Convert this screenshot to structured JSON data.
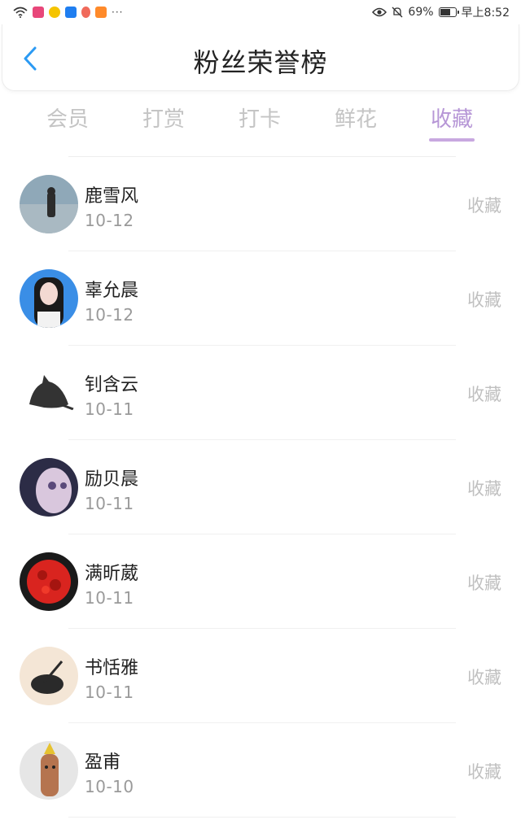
{
  "status_bar": {
    "battery": "69%",
    "time": "早上8:52",
    "battery_level": 0.69
  },
  "header": {
    "title": "粉丝荣誉榜"
  },
  "tabs": [
    {
      "label": "会员",
      "active": false
    },
    {
      "label": "打赏",
      "active": false
    },
    {
      "label": "打卡",
      "active": false
    },
    {
      "label": "鲜花",
      "active": false
    },
    {
      "label": "收藏",
      "active": true
    }
  ],
  "colors": {
    "accent": "#b696d6",
    "back": "#2b9af3",
    "tab_inactive": "#c4c4c4"
  },
  "fans": [
    {
      "name": "鹿雪风",
      "date": "10-12",
      "action": "收藏"
    },
    {
      "name": "辜允晨",
      "date": "10-12",
      "action": "收藏"
    },
    {
      "name": "钊含云",
      "date": "10-11",
      "action": "收藏"
    },
    {
      "name": "励贝晨",
      "date": "10-11",
      "action": "收藏"
    },
    {
      "name": "满昕葳",
      "date": "10-11",
      "action": "收藏"
    },
    {
      "name": "书恬雅",
      "date": "10-11",
      "action": "收藏"
    },
    {
      "name": "盈甫",
      "date": "10-10",
      "action": "收藏"
    }
  ]
}
